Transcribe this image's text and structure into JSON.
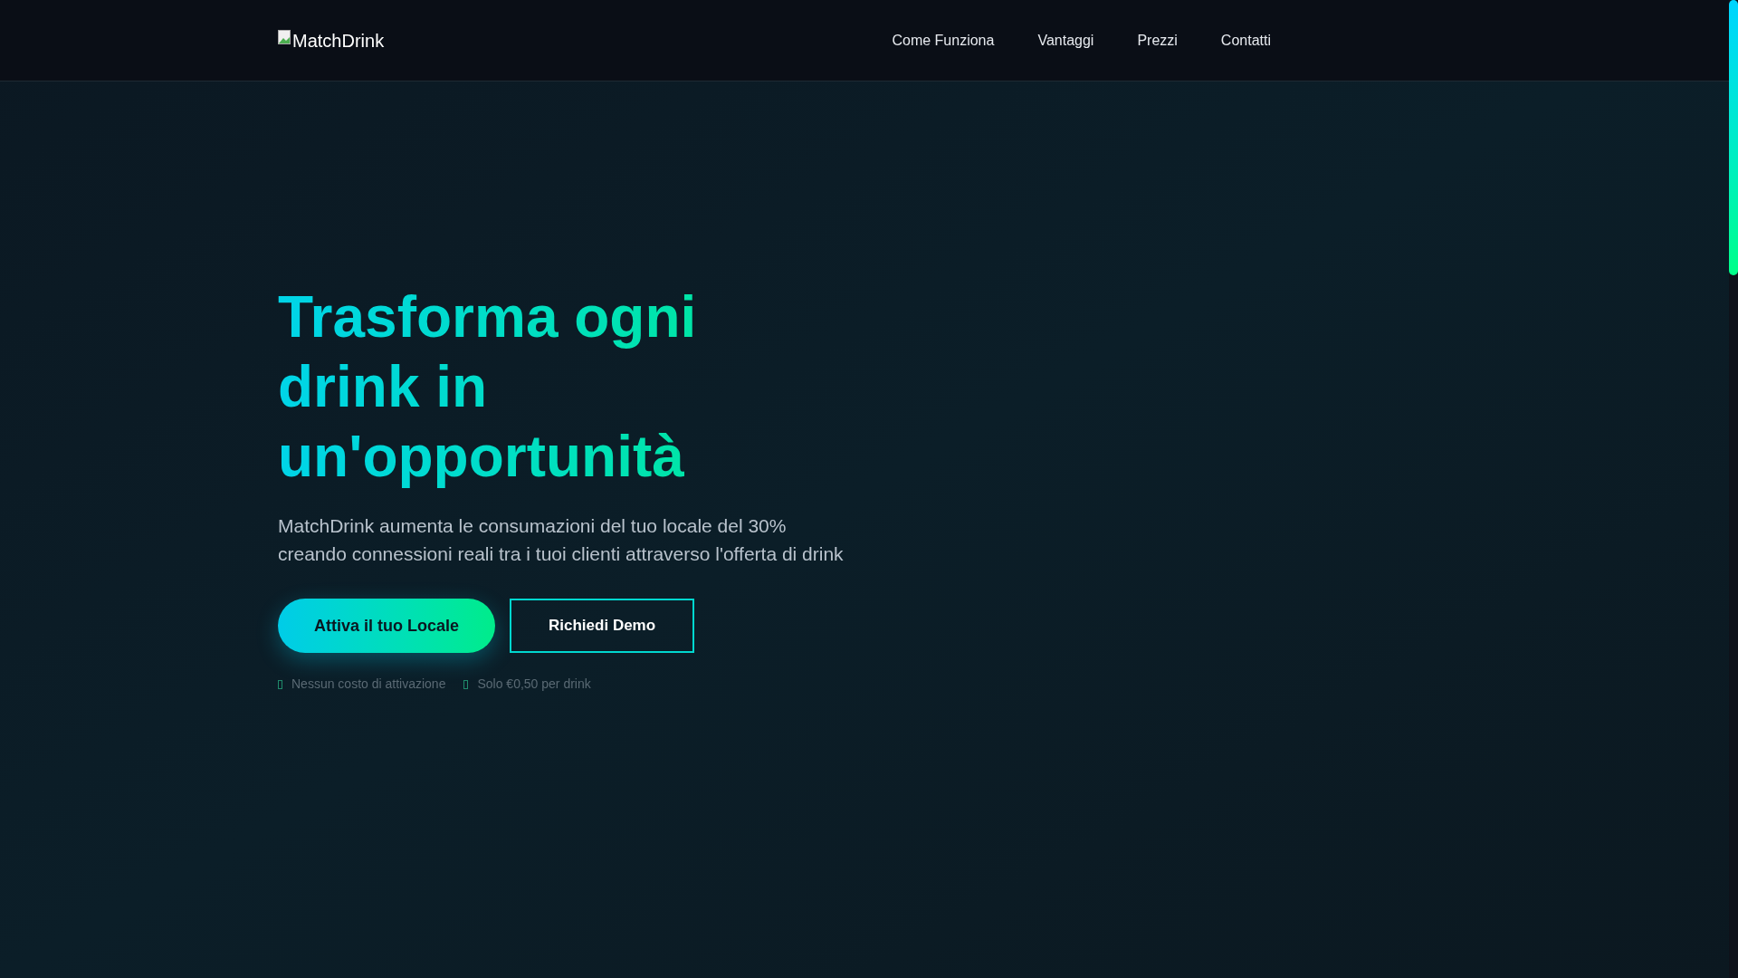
{
  "header": {
    "logo_alt": "MatchDrink",
    "nav": [
      {
        "label": "Come Funziona"
      },
      {
        "label": "Vantaggi"
      },
      {
        "label": "Prezzi"
      },
      {
        "label": "Contatti"
      }
    ]
  },
  "hero": {
    "title": "Trasforma ogni drink in un'opportunità",
    "subtitle": "MatchDrink aumenta le consumazioni del tuo locale del 30% creando connessioni reali tra i tuoi clienti attraverso l'offerta di drink",
    "buttons": [
      {
        "label": "Attiva il tuo Locale",
        "kind": "primary"
      },
      {
        "label": "Richiedi Demo",
        "kind": "outline"
      }
    ],
    "features": [
      {
        "text": "Nessun costo di attivazione"
      },
      {
        "text": "Solo €0,50 per drink"
      }
    ]
  }
}
